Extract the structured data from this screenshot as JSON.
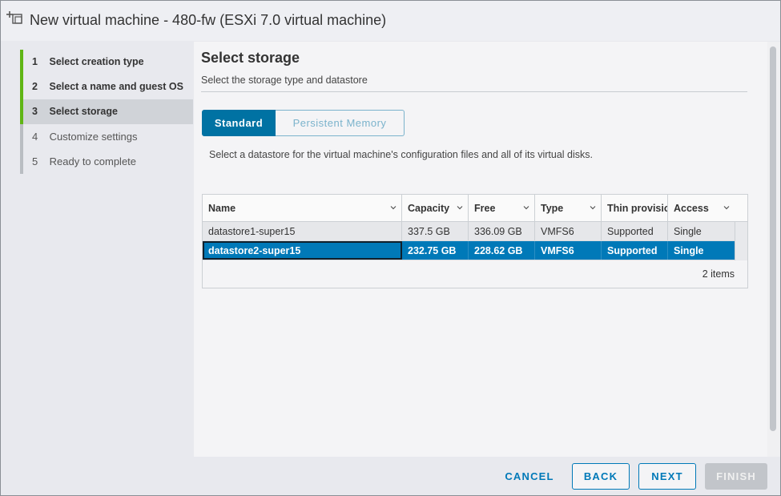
{
  "window": {
    "title": "New virtual machine - 480-fw (ESXi 7.0 virtual machine)"
  },
  "steps": [
    {
      "num": "1",
      "label": "Select creation type"
    },
    {
      "num": "2",
      "label": "Select a name and guest OS"
    },
    {
      "num": "3",
      "label": "Select storage"
    },
    {
      "num": "4",
      "label": "Customize settings"
    },
    {
      "num": "5",
      "label": "Ready to complete"
    }
  ],
  "main": {
    "title": "Select storage",
    "subtitle": "Select the storage type and datastore",
    "tabs": {
      "standard": "Standard",
      "persistent": "Persistent Memory"
    },
    "description": "Select a datastore for the virtual machine's configuration files and all of its virtual disks."
  },
  "grid": {
    "columns": [
      "Name",
      "Capacity",
      "Free",
      "Type",
      "Thin provisioning",
      "Access"
    ],
    "rows": [
      [
        "datastore1-super15",
        "337.5 GB",
        "336.09 GB",
        "VMFS6",
        "Supported",
        "Single"
      ],
      [
        "datastore2-super15",
        "232.75 GB",
        "228.62 GB",
        "VMFS6",
        "Supported",
        "Single"
      ]
    ],
    "footer": "2 items"
  },
  "buttons": {
    "cancel": "CANCEL",
    "back": "BACK",
    "next": "NEXT",
    "finish": "FINISH"
  },
  "colors": {
    "accent": "#0079b8",
    "selected_row": "#0079b8",
    "progress": "#60b515"
  }
}
